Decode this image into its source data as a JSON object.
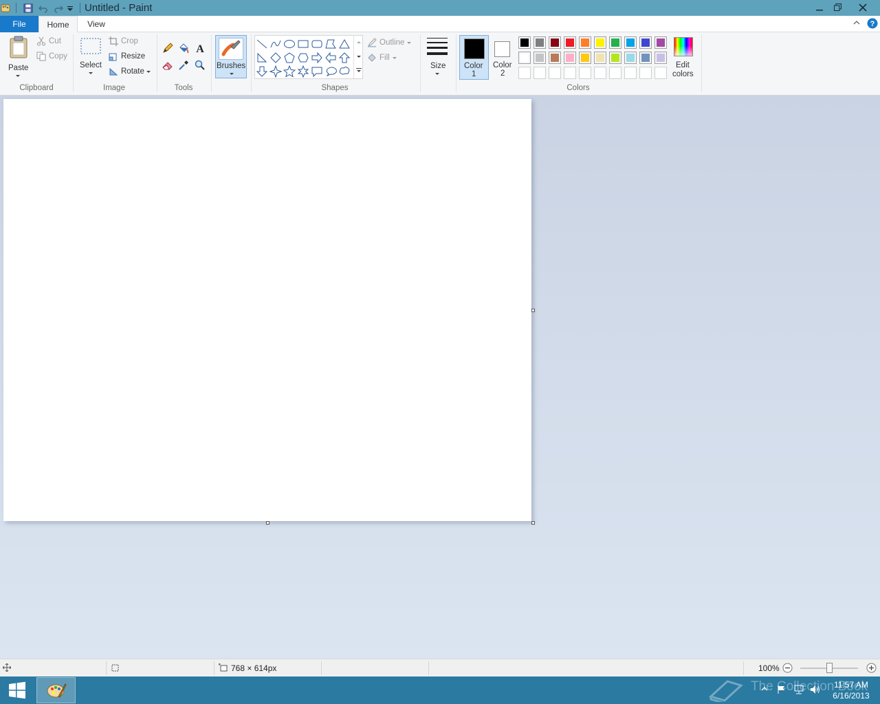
{
  "window": {
    "title": "Untitled - Paint",
    "minimize_glyph": "─",
    "restore_glyph": "❐",
    "close_glyph": "✕"
  },
  "tabs": {
    "file": "File",
    "home": "Home",
    "view": "View"
  },
  "clipboard": {
    "paste": "Paste",
    "cut": "Cut",
    "copy": "Copy",
    "label": "Clipboard"
  },
  "image": {
    "select": "Select",
    "crop": "Crop",
    "resize": "Resize",
    "rotate": "Rotate",
    "label": "Image"
  },
  "tools": {
    "label": "Tools"
  },
  "brushes": {
    "label": "Brushes"
  },
  "shapes": {
    "outline": "Outline",
    "fill": "Fill",
    "label": "Shapes"
  },
  "size": {
    "label": "Size"
  },
  "colors": {
    "color1_line1": "Color",
    "color1_line2": "1",
    "color2_line1": "Color",
    "color2_line2": "2",
    "edit_line1": "Edit",
    "edit_line2": "colors",
    "label": "Colors",
    "color1_value": "#000000",
    "color2_value": "#ffffff",
    "palette_row1": [
      "#000000",
      "#7f7f7f",
      "#880015",
      "#ed1c24",
      "#ff7f27",
      "#fff200",
      "#22b14c",
      "#00a2e8",
      "#3f48cc",
      "#a349a4"
    ],
    "palette_row2": [
      "#ffffff",
      "#c3c3c3",
      "#b97a57",
      "#ffaec9",
      "#ffc90e",
      "#efe4b0",
      "#b5e61d",
      "#99d9ea",
      "#7092be",
      "#c8bfe7"
    ]
  },
  "status": {
    "dimensions": "768 × 614px",
    "zoom": "100%"
  },
  "taskbar": {
    "time": "11:57 AM",
    "date": "6/16/2013"
  },
  "watermark": {
    "text": "The Collection Book"
  }
}
